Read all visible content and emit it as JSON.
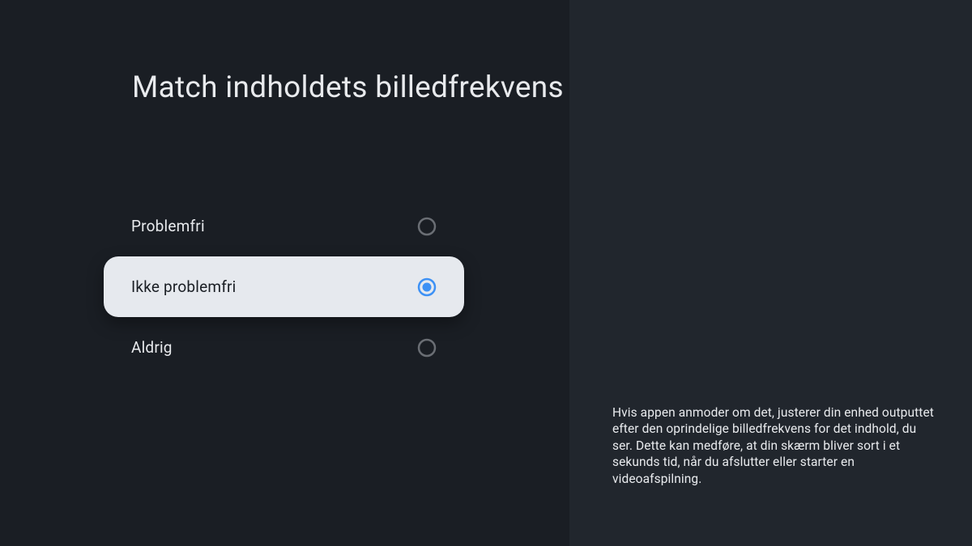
{
  "title": "Match indholdets billedfrekvens",
  "options": [
    {
      "label": "Problemfri",
      "selected": false
    },
    {
      "label": "Ikke problemfri",
      "selected": true
    },
    {
      "label": "Aldrig",
      "selected": false
    }
  ],
  "description": "Hvis appen anmoder om det, justerer din enhed outputtet efter den oprindelige billedfrekvens for det indhold, du ser. Dette kan medføre, at din skærm bliver sort i et sekunds tid, når du afslutter eller starter en videoafspilning."
}
